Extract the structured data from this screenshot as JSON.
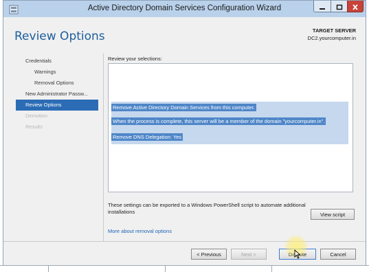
{
  "window": {
    "title": "Active Directory Domain Services Configuration Wizard"
  },
  "header": {
    "page_title": "Review Options",
    "target_label": "TARGET SERVER",
    "target_server": "DC2.yourcomputer.in"
  },
  "nav": {
    "items": [
      {
        "label": "Credentials",
        "state": "normal"
      },
      {
        "label": "Warnings",
        "state": "normal"
      },
      {
        "label": "Removal Options",
        "state": "normal"
      },
      {
        "label": "New Administrator Passw...",
        "state": "normal"
      },
      {
        "label": "Review Options",
        "state": "selected"
      },
      {
        "label": "Demotion",
        "state": "disabled"
      },
      {
        "label": "Results",
        "state": "disabled"
      }
    ]
  },
  "main": {
    "review_label": "Review your selections:",
    "selections": [
      "Remove Active Directory Domain Services from this computer.",
      "When the process is complete, this server will be a member of the domain \"yourcomputer.in\".",
      "Remove DNS Delegation: Yes"
    ],
    "export_text": "These settings can be exported to a Windows PowerShell script to automate additional installations",
    "view_script_label": "View script",
    "more_link": "More about removal options"
  },
  "footer": {
    "previous_label": "< Previous",
    "next_label": "Next >",
    "demote_label": "Demote",
    "cancel_label": "Cancel"
  },
  "colors": {
    "accent": "#2b6cb5",
    "title": "#1c5d9c",
    "selection": "#4f86c8",
    "close_button": "#c7433a"
  }
}
